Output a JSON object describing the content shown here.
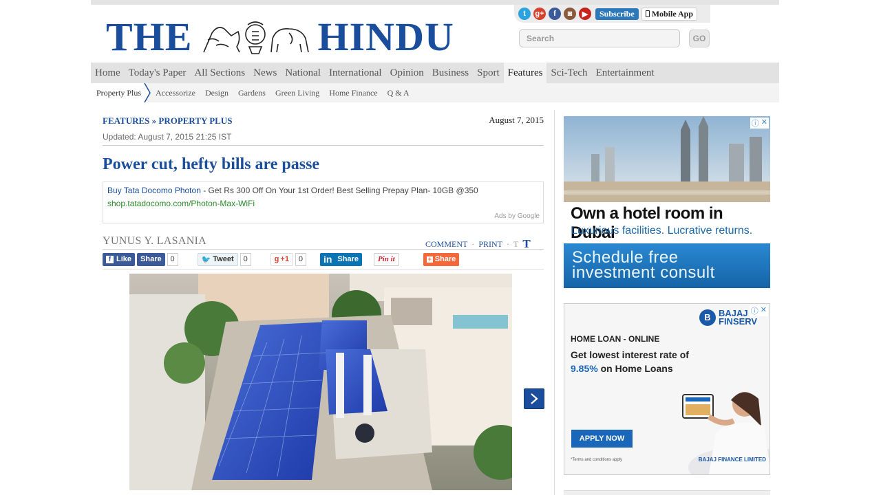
{
  "masthead": {
    "word1": "THE",
    "word2": "HINDU",
    "search_placeholder": "Search",
    "go": "GO",
    "subscribe": "Subscribe",
    "mobile_app": "Mobile App"
  },
  "social_icons": [
    "twitter-icon",
    "google-plus-icon",
    "facebook-icon",
    "instagram-icon",
    "youtube-icon"
  ],
  "nav": [
    "Home",
    "Today's Paper",
    "All Sections",
    "News",
    "National",
    "International",
    "Opinion",
    "Business",
    "Sport",
    "Features",
    "Sci-Tech",
    "Entertainment"
  ],
  "nav_active": "Features",
  "subnav": [
    "Property Plus",
    "Accessorize",
    "Design",
    "Gardens",
    "Green Living",
    "Home Finance",
    "Q & A"
  ],
  "article": {
    "breadcrumb": "FEATURES » PROPERTY PLUS",
    "date": "August 7, 2015",
    "updated": "Updated: August 7, 2015 21:25 IST",
    "title": "Power cut, hefty bills are passe",
    "author": "YUNUS Y. LASANIA",
    "comment": "COMMENT",
    "print": "PRINT",
    "dot": "·",
    "text_small": "T",
    "text_large": "T"
  },
  "text_ad": {
    "link": "Buy Tata Docomo Photon",
    "dash": " - ",
    "desc": "Get Rs 300 Off On Your 1st Order! Best Selling Prepay Plan- 10GB @350",
    "url": "shop.tatadocomo.com/Photon-Max-WiFi",
    "by": "Ads by Google"
  },
  "share": {
    "like": "Like",
    "fb_share": "Share",
    "fb_count": "0",
    "tweet": "Tweet",
    "tw_count": "0",
    "gplus": "+1",
    "gp_count": "0",
    "in_share": "Share",
    "pinit": "Pin it",
    "share": "Share"
  },
  "ad_dubai": {
    "headline": "Own a hotel room in Dubai",
    "sub": "Luxurious facilities. Lucrative returns.",
    "cta_line1": "Schedule free",
    "cta_line2": "investment consult"
  },
  "ad_bajaj": {
    "brand1": "BAJAJ",
    "brand2": "FINSERV",
    "line1": "HOME LOAN - ONLINE",
    "line2": "Get lowest interest rate of",
    "rate": "9.85%",
    "line3": " on Home Loans",
    "apply": "APPLY NOW",
    "tc": "*Terms and conditions apply",
    "company": "BAJAJ FINANCE LIMITED"
  },
  "colors": {
    "brand_blue": "#1a4e9c",
    "nav_bg": "#e2e2e2",
    "subnav_bg": "#f3f3f3"
  }
}
